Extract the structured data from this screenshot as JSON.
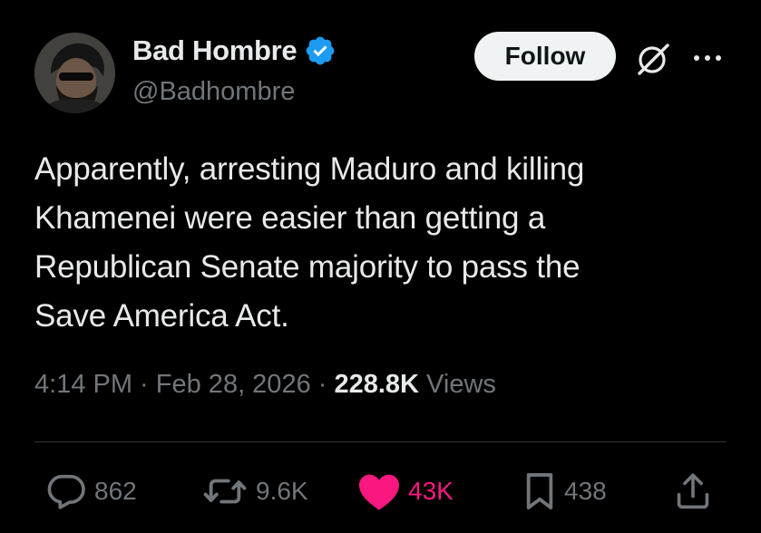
{
  "author": {
    "display_name": "Bad Hombre",
    "handle": "@Badhombre",
    "verified": true
  },
  "header": {
    "follow_label": "Follow",
    "icons": [
      "grok-icon",
      "more-icon"
    ]
  },
  "tweet": {
    "text": "Apparently, arresting Maduro and killing\nKhamenei were easier than getting a\nRepublican Senate majority to pass the\nSave America Act.",
    "time": "4:14 PM",
    "separator": " · ",
    "date": "Feb 28, 2026",
    "views_count": "228.8K",
    "views_label": " Views"
  },
  "actions": {
    "replies": "862",
    "reposts": "9.6K",
    "likes": "43K",
    "bookmarks": "438"
  },
  "colors": {
    "background": "#000000",
    "text": "#e7e9ea",
    "secondary": "#71767b",
    "verified": "#1d9bf0",
    "like": "#f91880",
    "follow_bg": "#eff3f4"
  }
}
